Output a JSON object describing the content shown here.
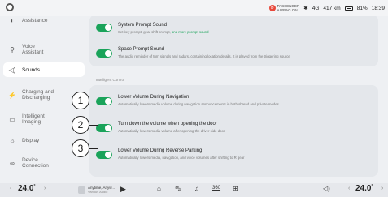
{
  "status_bar": {
    "airbag_line1": "PASSENGER",
    "airbag_line2": "AIRBAG ON",
    "bluetooth_icon": "bluetooth-icon",
    "network": "4G",
    "range": "417 km",
    "battery": "81%",
    "time": "18:39"
  },
  "sidebar": {
    "items": [
      {
        "label": "Assistance",
        "icon": "assistance-icon",
        "glyph": "◐"
      },
      {
        "label": "Voice Assistant",
        "icon": "voice-icon",
        "glyph": "⚲"
      },
      {
        "label": "Sounds",
        "icon": "speaker-icon",
        "glyph": "◁)"
      },
      {
        "label": "Charging and Discharging",
        "icon": "charging-icon",
        "glyph": "⚡"
      },
      {
        "label": "Intelligent Imaging",
        "icon": "imaging-icon",
        "glyph": "▭"
      },
      {
        "label": "Display",
        "icon": "display-icon",
        "glyph": "☼"
      },
      {
        "label": "Device Connection",
        "icon": "link-icon",
        "glyph": "∞"
      }
    ]
  },
  "main": {
    "top_card": {
      "rows": [
        {
          "title": "System Prompt Sound",
          "desc": "Set key prompt, gear shift prompt, ",
          "link": "and more prompt sound",
          "on": true
        },
        {
          "title": "Space Prompt Sound",
          "desc": "The audio reminder of turn signals and radars, containing location details. It is played from the triggering source",
          "on": true
        }
      ]
    },
    "section_label": "Intelligent Control",
    "control_card": {
      "rows": [
        {
          "title": "Lower Volume During Navigation",
          "desc": "Automatically lowers media volume during navigation announcements in both shared and private modes",
          "on": true
        },
        {
          "title": "Turn down the volume when opening the door",
          "desc": "Automatically lowers media volume after opening the driver side door",
          "on": true
        },
        {
          "title": "Lower Volume During Reverse Parking",
          "desc": "Automatically lowers media, navigation, and voice volumes after shifting to R gear",
          "on": true
        }
      ]
    }
  },
  "callouts": [
    "1",
    "2",
    "3"
  ],
  "dock": {
    "left_temp": "24.0",
    "right_temp": "24.0",
    "degree": "°",
    "music_title": "Anytime, Anyw...",
    "music_artist": "Various Audio",
    "icons": [
      "play-icon",
      "home-icon",
      "car-icon",
      "music-icon",
      "360-icon",
      "apps-icon",
      "volume-icon"
    ],
    "label_360": "360"
  }
}
